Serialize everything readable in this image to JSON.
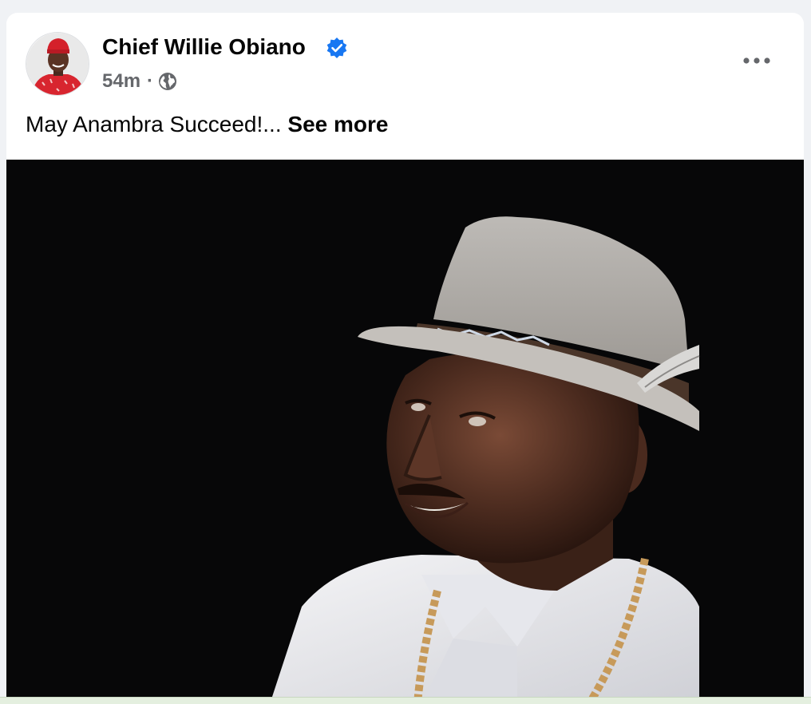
{
  "post": {
    "author_name": "Chief Willie Obiano",
    "verified": true,
    "time": "54m",
    "separator": "·",
    "privacy_icon": "globe-icon",
    "text": "May Anambra Succeed!...",
    "see_more_label": "See more",
    "more_icon": "more-horizontal-icon"
  },
  "colors": {
    "verified_badge": "#1877f2",
    "meta_text": "#65676b",
    "primary_text": "#050505",
    "photo_background": "#070708"
  }
}
